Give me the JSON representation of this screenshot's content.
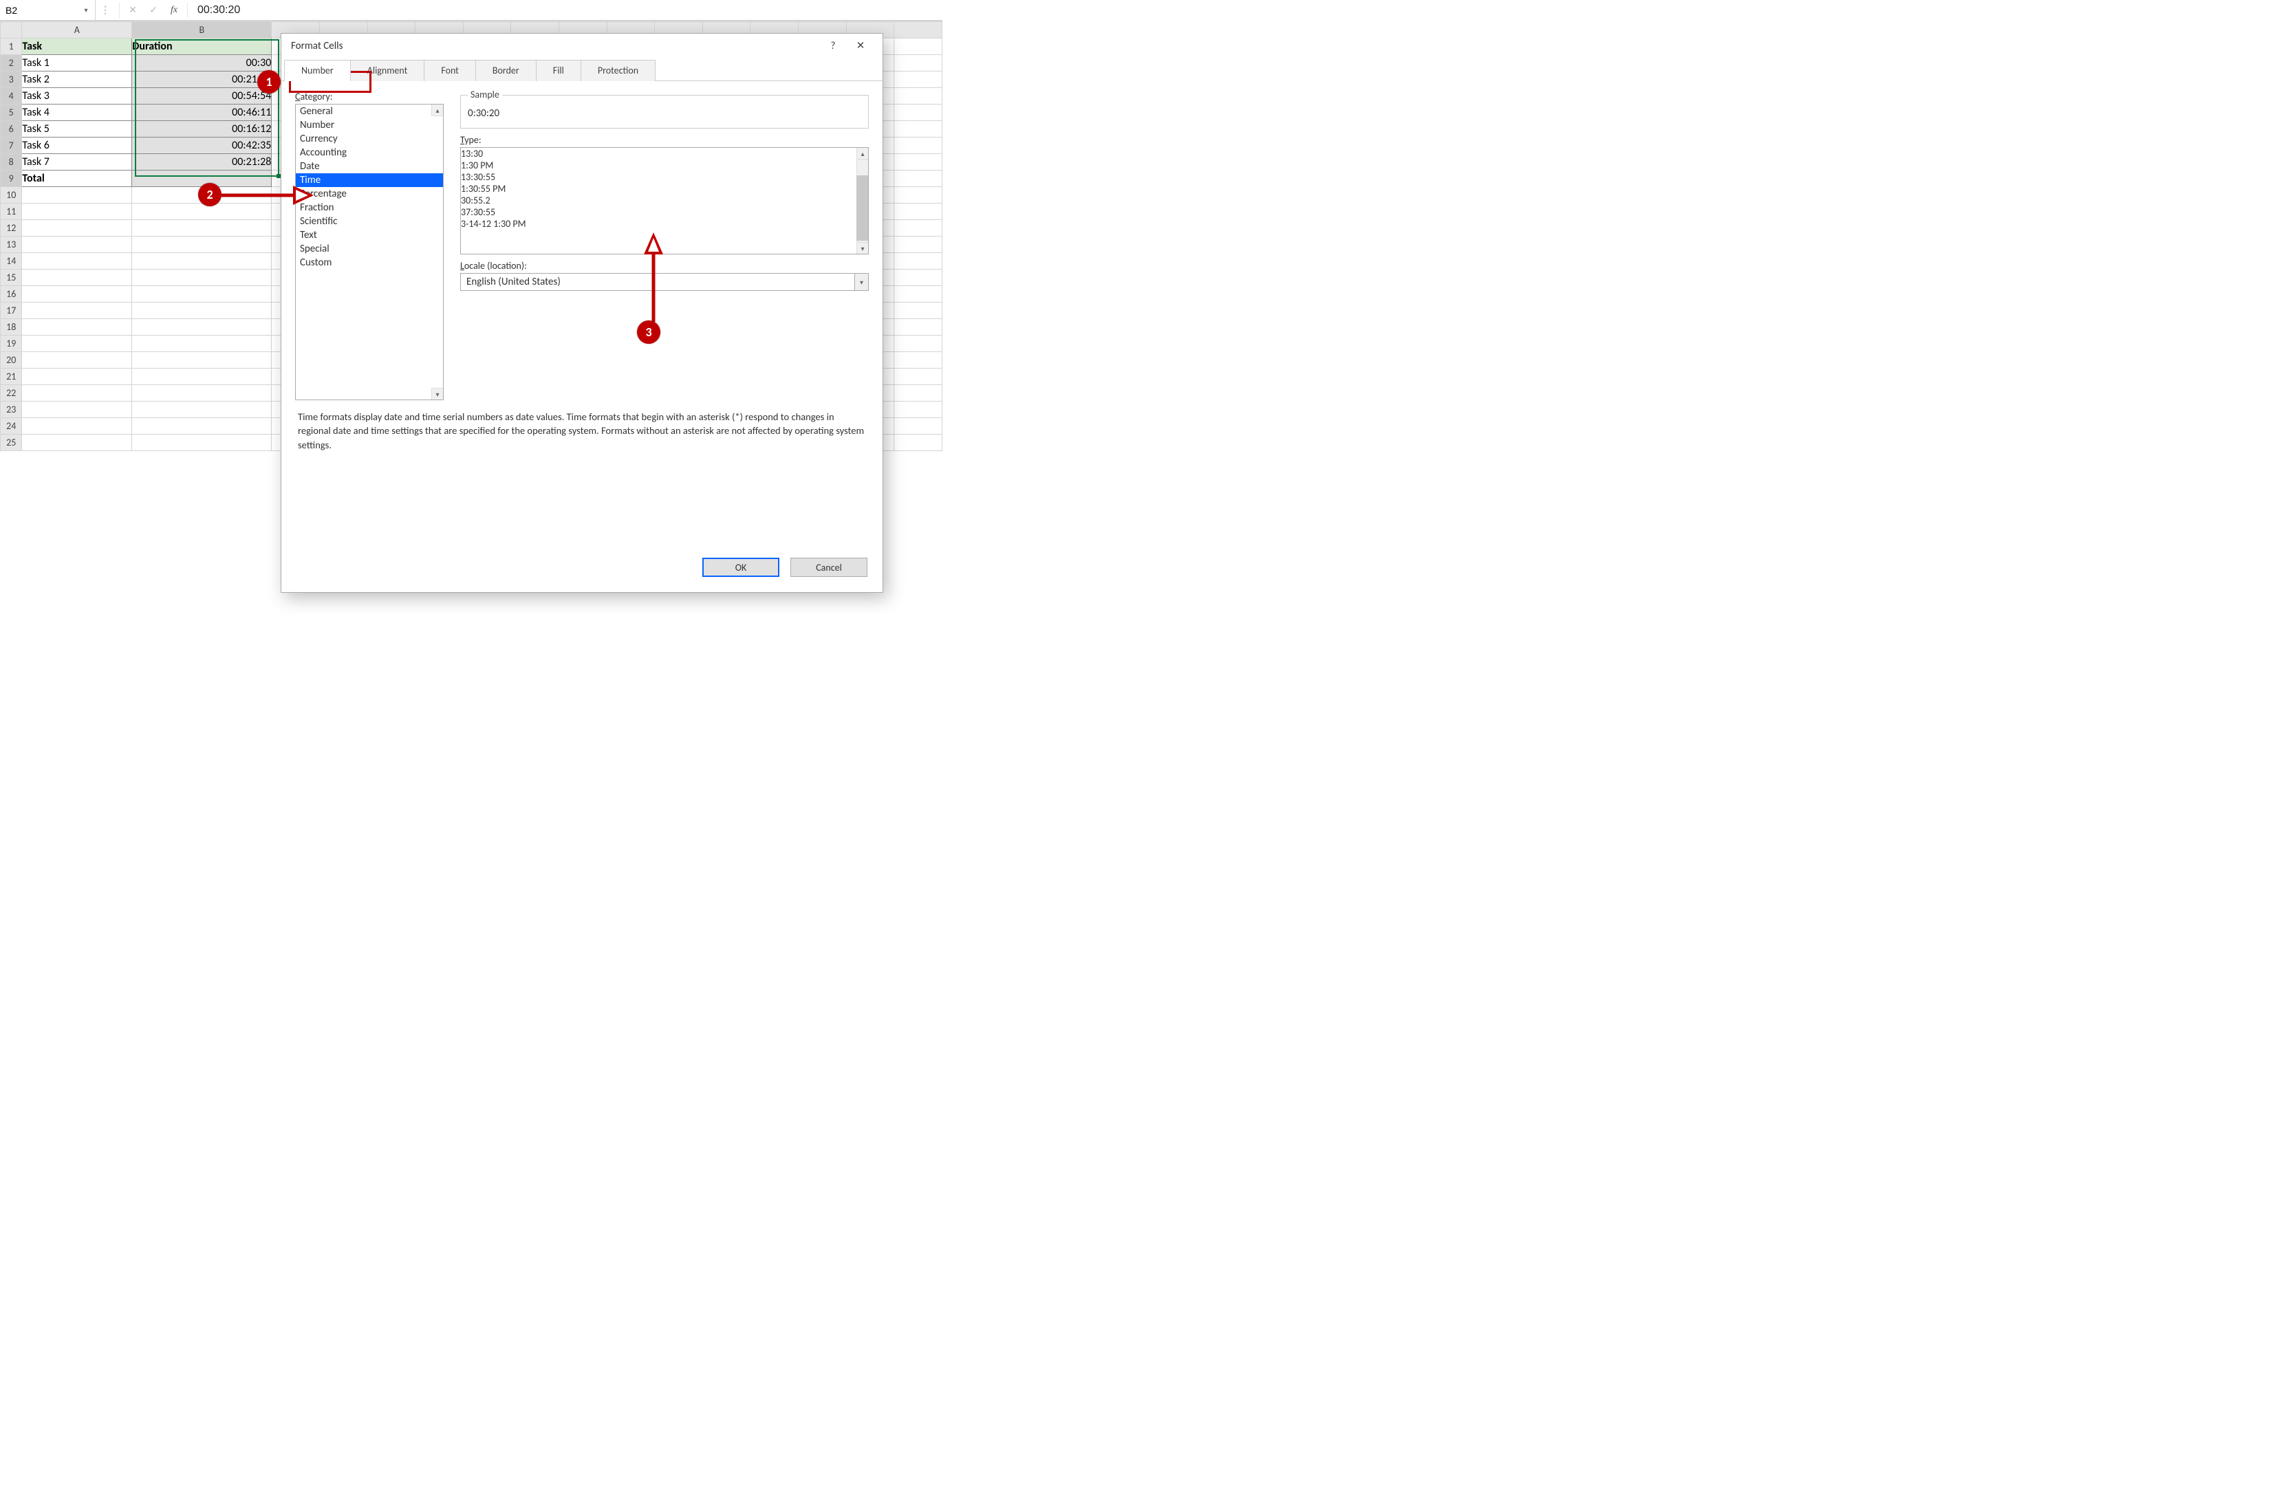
{
  "formula_bar": {
    "name_box": "B2",
    "fx_label": "fx",
    "value": "00:30:20"
  },
  "columns": [
    "A",
    "B"
  ],
  "row_numbers": [
    "1",
    "2",
    "3",
    "4",
    "5",
    "6",
    "7",
    "8",
    "9",
    "10",
    "11",
    "12",
    "13",
    "14",
    "15",
    "16",
    "17",
    "18",
    "19",
    "20",
    "21",
    "22",
    "23",
    "24",
    "25"
  ],
  "headers": {
    "A": "Task",
    "B": "Duration"
  },
  "rows": [
    {
      "task": "Task 1",
      "dur": "00:30"
    },
    {
      "task": "Task 2",
      "dur": "00:21:13"
    },
    {
      "task": "Task 3",
      "dur": "00:54:54"
    },
    {
      "task": "Task 4",
      "dur": "00:46:11"
    },
    {
      "task": "Task 5",
      "dur": "00:16:12"
    },
    {
      "task": "Task 6",
      "dur": "00:42:35"
    },
    {
      "task": "Task 7",
      "dur": "00:21:28"
    }
  ],
  "total_label": "Total",
  "dialog": {
    "title": "Format Cells",
    "help": "?",
    "close": "✕",
    "tabs": [
      "Number",
      "Alignment",
      "Font",
      "Border",
      "Fill",
      "Protection"
    ],
    "active_tab": 0,
    "category_label": "Category:",
    "categories": [
      "General",
      "Number",
      "Currency",
      "Accounting",
      "Date",
      "Time",
      "Percentage",
      "Fraction",
      "Scientific",
      "Text",
      "Special",
      "Custom"
    ],
    "category_selected": "Time",
    "sample_label": "Sample",
    "sample_value": "0:30:20",
    "type_label": "Type:",
    "types": [
      "13:30",
      "1:30 PM",
      "13:30:55",
      "1:30:55 PM",
      "30:55.2",
      "37:30:55",
      "3-14-12 1:30 PM"
    ],
    "type_selected": "13:30:55",
    "locale_label": "Locale (location):",
    "locale_value": "English (United States)",
    "description": "Time formats display date and time serial numbers as date values.  Time formats that begin with an asterisk (*) respond to changes in regional date and time settings that are specified for the operating system.  Formats without an asterisk are not affected by operating system settings.",
    "ok": "OK",
    "cancel": "Cancel"
  },
  "annotations": {
    "b1": "1",
    "b2": "2",
    "b3": "3"
  }
}
